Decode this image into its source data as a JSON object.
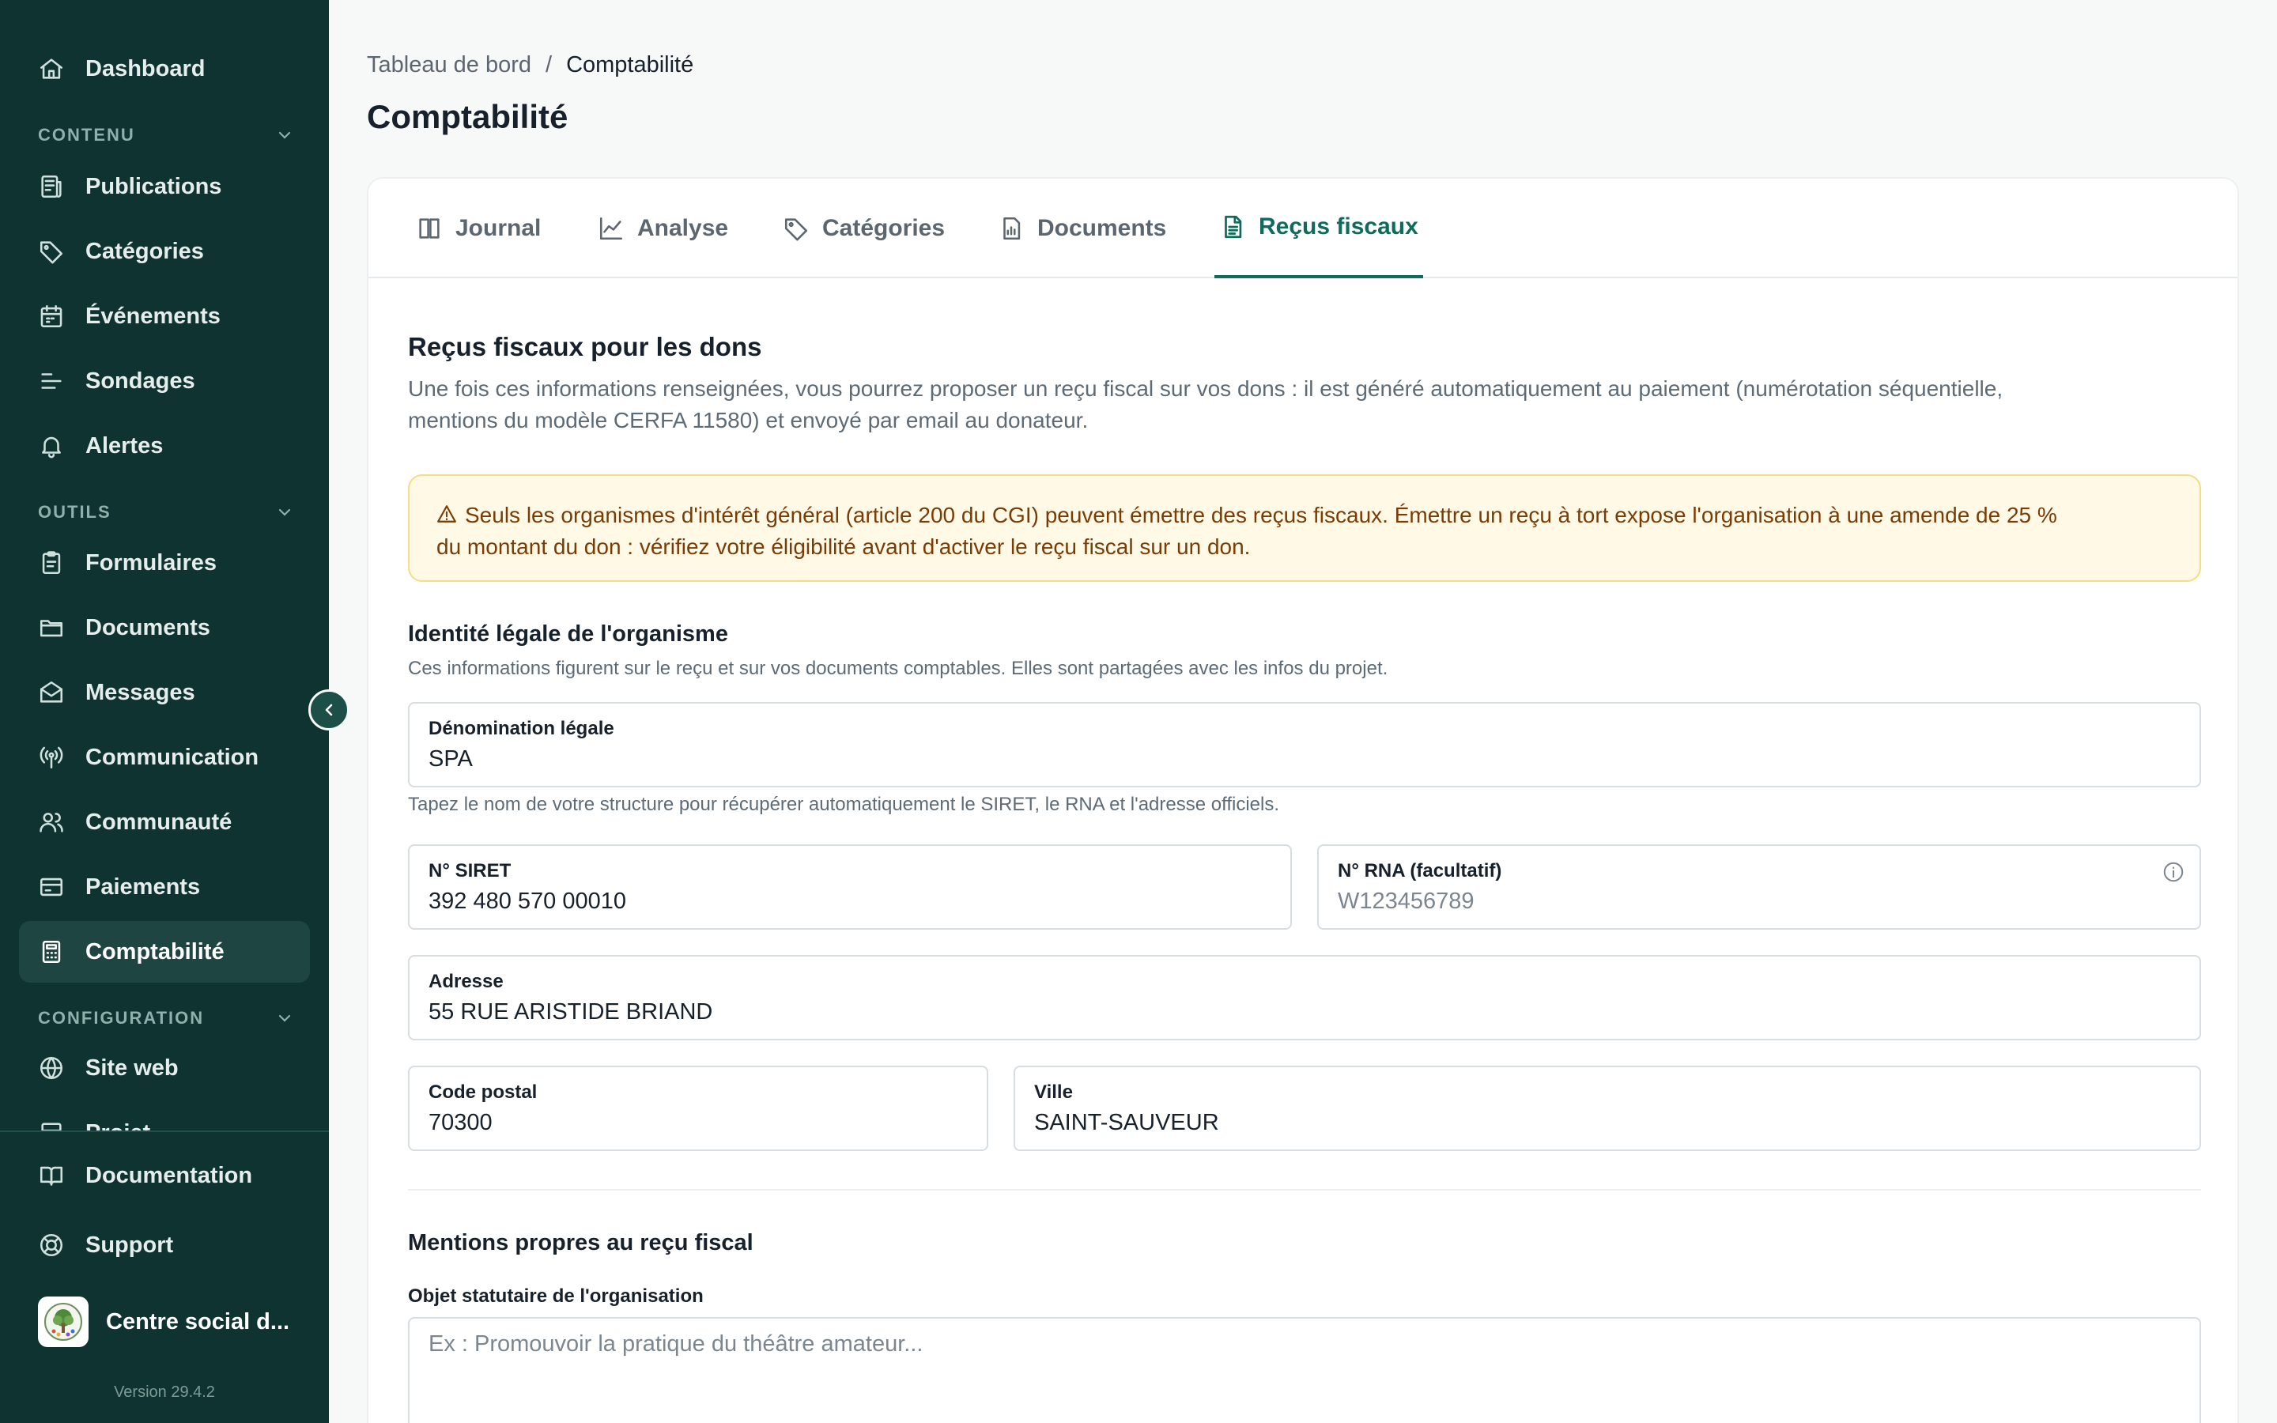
{
  "sidebar": {
    "items": [
      {
        "label": "Dashboard",
        "icon": "home-icon"
      },
      {
        "label": "Publications",
        "icon": "newspaper-icon"
      },
      {
        "label": "Catégories",
        "icon": "tag-icon"
      },
      {
        "label": "Événements",
        "icon": "calendar-icon"
      },
      {
        "label": "Sondages",
        "icon": "poll-icon"
      },
      {
        "label": "Alertes",
        "icon": "bell-icon"
      },
      {
        "label": "Formulaires",
        "icon": "clipboard-icon"
      },
      {
        "label": "Documents",
        "icon": "folder-icon"
      },
      {
        "label": "Messages",
        "icon": "mail-icon"
      },
      {
        "label": "Communication",
        "icon": "broadcast-icon"
      },
      {
        "label": "Communauté",
        "icon": "users-icon"
      },
      {
        "label": "Paiements",
        "icon": "wallet-icon"
      },
      {
        "label": "Comptabilité",
        "icon": "calculator-icon",
        "active": true
      },
      {
        "label": "Site web",
        "icon": "globe-icon"
      },
      {
        "label": "Projet",
        "icon": "project-icon"
      }
    ],
    "sections": {
      "contenu": "CONTENU",
      "outils": "OUTILS",
      "configuration": "CONFIGURATION"
    },
    "footer": {
      "documentation": "Documentation",
      "support": "Support",
      "org_name": "Centre social d...",
      "version": "Version 29.4.2"
    }
  },
  "header": {
    "breadcrumb": [
      "Tableau de bord",
      "/",
      "Comptabilité"
    ],
    "title": "Comptabilité"
  },
  "tabs": [
    {
      "label": "Journal",
      "icon": "book-icon"
    },
    {
      "label": "Analyse",
      "icon": "chart-line-icon"
    },
    {
      "label": "Catégories",
      "icon": "tag-icon"
    },
    {
      "label": "Documents",
      "icon": "report-icon"
    },
    {
      "label": "Reçus fiscaux",
      "icon": "receipt-icon",
      "active": true
    }
  ],
  "content": {
    "title": "Reçus fiscaux pour les dons",
    "desc_line1": "Une fois ces informations renseignées, vous pourrez proposer un reçu fiscal sur vos dons : il est généré automatiquement au paiement (numérotation séquentielle,",
    "desc_line2": "mentions du modèle CERFA 11580) et envoyé par email au donateur.",
    "warning_line1": "Seuls les organismes d'intérêt général (article 200 du CGI) peuvent émettre des reçus fiscaux. Émettre un reçu à tort expose l'organisation à une amende de 25 %",
    "warning_line2": "du montant du don : vérifiez votre éligibilité avant d'activer le reçu fiscal sur un don.",
    "identity": {
      "title": "Identité légale de l'organisme",
      "desc": "Ces informations figurent sur le reçu et sur vos documents comptables. Elles sont partagées avec les infos du projet.",
      "denomination_label": "Dénomination légale",
      "denomination_value": "SPA",
      "denomination_hint": "Tapez le nom de votre structure pour récupérer automatiquement le SIRET, le RNA et l'adresse officiels.",
      "siret_label": "N° SIRET",
      "siret_value": "392 480 570 00010",
      "rna_label": "N° RNA (facultatif)",
      "rna_placeholder": "W123456789",
      "address_label": "Adresse",
      "address_value": "55 RUE ARISTIDE BRIAND",
      "postal_label": "Code postal",
      "postal_value": "70300",
      "city_label": "Ville",
      "city_value": "SAINT-SAUVEUR"
    },
    "mentions": {
      "title": "Mentions propres au reçu fiscal",
      "object_label": "Objet statutaire de l'organisation",
      "object_placeholder": "Ex : Promouvoir la pratique du théâtre amateur..."
    }
  },
  "colors": {
    "sidebar_bg": "#0e3330",
    "accent": "#0f6b5b",
    "warning_bg": "#fff9e6",
    "warning_text": "#7a3b05"
  }
}
